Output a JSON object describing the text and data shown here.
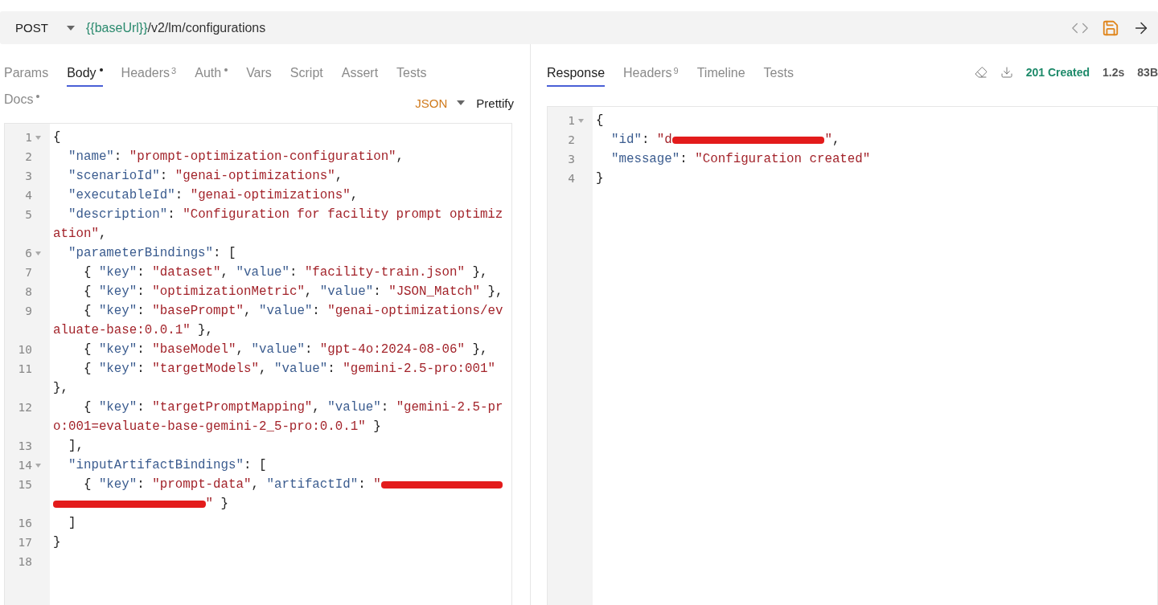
{
  "request": {
    "method": "POST",
    "url_variable": "{{baseUrl}}",
    "url_path": "/v2/lm/configurations"
  },
  "request_tabs": [
    {
      "label": "Params",
      "selected": false,
      "modified": false
    },
    {
      "label": "Body",
      "selected": true,
      "modified": true
    },
    {
      "label": "Headers",
      "count": "3",
      "selected": false,
      "modified": false
    },
    {
      "label": "Auth",
      "selected": false,
      "modified": true
    },
    {
      "label": "Vars",
      "selected": false,
      "modified": false
    },
    {
      "label": "Script",
      "selected": false,
      "modified": false
    },
    {
      "label": "Assert",
      "selected": false,
      "modified": false
    },
    {
      "label": "Tests",
      "selected": false,
      "modified": false
    },
    {
      "label": "Docs",
      "selected": false,
      "modified": true
    }
  ],
  "body_mode": {
    "format": "JSON",
    "action": "Prettify"
  },
  "request_body": [
    {
      "number": "1",
      "fold": true,
      "segments": [
        {
          "kind": "punct",
          "text": "{"
        }
      ]
    },
    {
      "number": "2",
      "fold": false,
      "segments": [
        {
          "kind": "key",
          "text": "  \"name\""
        },
        {
          "kind": "punct",
          "text": ": "
        },
        {
          "kind": "str",
          "text": "\"prompt-optimization-configuration\""
        },
        {
          "kind": "punct",
          "text": ","
        }
      ]
    },
    {
      "number": "3",
      "fold": false,
      "segments": [
        {
          "kind": "key",
          "text": "  \"scenarioId\""
        },
        {
          "kind": "punct",
          "text": ": "
        },
        {
          "kind": "str",
          "text": "\"genai-optimizations\""
        },
        {
          "kind": "punct",
          "text": ","
        }
      ]
    },
    {
      "number": "4",
      "fold": false,
      "segments": [
        {
          "kind": "key",
          "text": "  \"executableId\""
        },
        {
          "kind": "punct",
          "text": ": "
        },
        {
          "kind": "str",
          "text": "\"genai-optimizations\""
        },
        {
          "kind": "punct",
          "text": ","
        }
      ]
    },
    {
      "number": "5",
      "fold": false,
      "segments": [
        {
          "kind": "key",
          "text": "  \"description\""
        },
        {
          "kind": "punct",
          "text": ": "
        },
        {
          "kind": "str",
          "text": "\"Configuration for facility prompt optimiz"
        }
      ]
    },
    {
      "fold": false,
      "segments": [
        {
          "kind": "str",
          "text": "ation\""
        },
        {
          "kind": "punct",
          "text": ","
        }
      ]
    },
    {
      "number": "6",
      "fold": true,
      "segments": [
        {
          "kind": "key",
          "text": "  \"parameterBindings\""
        },
        {
          "kind": "punct",
          "text": ": ["
        }
      ]
    },
    {
      "number": "7",
      "fold": false,
      "segments": [
        {
          "kind": "punct",
          "text": "    { "
        },
        {
          "kind": "key",
          "text": "\"key\""
        },
        {
          "kind": "punct",
          "text": ": "
        },
        {
          "kind": "str",
          "text": "\"dataset\""
        },
        {
          "kind": "punct",
          "text": ", "
        },
        {
          "kind": "key",
          "text": "\"value\""
        },
        {
          "kind": "punct",
          "text": ": "
        },
        {
          "kind": "str",
          "text": "\"facility-train.json\""
        },
        {
          "kind": "punct",
          "text": " },"
        }
      ]
    },
    {
      "number": "8",
      "fold": false,
      "segments": [
        {
          "kind": "punct",
          "text": "    { "
        },
        {
          "kind": "key",
          "text": "\"key\""
        },
        {
          "kind": "punct",
          "text": ": "
        },
        {
          "kind": "str",
          "text": "\"optimizationMetric\""
        },
        {
          "kind": "punct",
          "text": ", "
        },
        {
          "kind": "key",
          "text": "\"value\""
        },
        {
          "kind": "punct",
          "text": ": "
        },
        {
          "kind": "str",
          "text": "\"JSON_Match\""
        },
        {
          "kind": "punct",
          "text": " },"
        }
      ]
    },
    {
      "number": "9",
      "fold": false,
      "segments": [
        {
          "kind": "punct",
          "text": "    { "
        },
        {
          "kind": "key",
          "text": "\"key\""
        },
        {
          "kind": "punct",
          "text": ": "
        },
        {
          "kind": "str",
          "text": "\"basePrompt\""
        },
        {
          "kind": "punct",
          "text": ", "
        },
        {
          "kind": "key",
          "text": "\"value\""
        },
        {
          "kind": "punct",
          "text": ": "
        },
        {
          "kind": "str",
          "text": "\"genai-optimizations/ev"
        }
      ]
    },
    {
      "fold": false,
      "segments": [
        {
          "kind": "str",
          "text": "aluate-base:0.0.1\""
        },
        {
          "kind": "punct",
          "text": " },"
        }
      ]
    },
    {
      "number": "10",
      "fold": false,
      "segments": [
        {
          "kind": "punct",
          "text": "    { "
        },
        {
          "kind": "key",
          "text": "\"key\""
        },
        {
          "kind": "punct",
          "text": ": "
        },
        {
          "kind": "str",
          "text": "\"baseModel\""
        },
        {
          "kind": "punct",
          "text": ", "
        },
        {
          "kind": "key",
          "text": "\"value\""
        },
        {
          "kind": "punct",
          "text": ": "
        },
        {
          "kind": "str",
          "text": "\"gpt-4o:2024-08-06\""
        },
        {
          "kind": "punct",
          "text": " },"
        }
      ]
    },
    {
      "number": "11",
      "fold": false,
      "segments": [
        {
          "kind": "punct",
          "text": "    { "
        },
        {
          "kind": "key",
          "text": "\"key\""
        },
        {
          "kind": "punct",
          "text": ": "
        },
        {
          "kind": "str",
          "text": "\"targetModels\""
        },
        {
          "kind": "punct",
          "text": ", "
        },
        {
          "kind": "key",
          "text": "\"value\""
        },
        {
          "kind": "punct",
          "text": ": "
        },
        {
          "kind": "str",
          "text": "\"gemini-2.5-pro:001\""
        }
      ]
    },
    {
      "fold": false,
      "segments": [
        {
          "kind": "punct",
          "text": "},"
        }
      ]
    },
    {
      "number": "12",
      "fold": false,
      "segments": [
        {
          "kind": "punct",
          "text": "    { "
        },
        {
          "kind": "key",
          "text": "\"key\""
        },
        {
          "kind": "punct",
          "text": ": "
        },
        {
          "kind": "str",
          "text": "\"targetPromptMapping\""
        },
        {
          "kind": "punct",
          "text": ", "
        },
        {
          "kind": "key",
          "text": "\"value\""
        },
        {
          "kind": "punct",
          "text": ": "
        },
        {
          "kind": "str",
          "text": "\"gemini-2.5-pr"
        }
      ]
    },
    {
      "fold": false,
      "segments": [
        {
          "kind": "str",
          "text": "o:001=evaluate-base-gemini-2_5-pro:0.0.1\""
        },
        {
          "kind": "punct",
          "text": " }"
        }
      ]
    },
    {
      "number": "13",
      "fold": false,
      "segments": [
        {
          "kind": "punct",
          "text": "  ],"
        }
      ]
    },
    {
      "number": "14",
      "fold": true,
      "segments": [
        {
          "kind": "key",
          "text": "  \"inputArtifactBindings\""
        },
        {
          "kind": "punct",
          "text": ": ["
        }
      ]
    },
    {
      "number": "15",
      "fold": false,
      "segments": [
        {
          "kind": "punct",
          "text": "    { "
        },
        {
          "kind": "key",
          "text": "\"key\""
        },
        {
          "kind": "punct",
          "text": ": "
        },
        {
          "kind": "str",
          "text": "\"prompt-data\""
        },
        {
          "kind": "punct",
          "text": ", "
        },
        {
          "kind": "key",
          "text": "\"artifactId\""
        },
        {
          "kind": "punct",
          "text": ": "
        },
        {
          "kind": "str",
          "text": "\""
        },
        {
          "kind": "redacted"
        }
      ]
    },
    {
      "fold": false,
      "segments": [
        {
          "kind": "redacted"
        },
        {
          "kind": "str",
          "text": "\""
        },
        {
          "kind": "punct",
          "text": " }"
        }
      ]
    },
    {
      "number": "16",
      "fold": false,
      "segments": [
        {
          "kind": "punct",
          "text": "  ]"
        }
      ]
    },
    {
      "number": "17",
      "fold": false,
      "segments": [
        {
          "kind": "punct",
          "text": "}"
        }
      ]
    },
    {
      "number": "18",
      "fold": false
    }
  ],
  "response_tabs": [
    {
      "label": "Response",
      "selected": true
    },
    {
      "label": "Headers",
      "count": "9",
      "selected": false
    },
    {
      "label": "Timeline",
      "selected": false
    },
    {
      "label": "Tests",
      "selected": false
    }
  ],
  "response_status": {
    "status": "201 Created",
    "time": "1.2s",
    "size": "83B"
  },
  "response_body": [
    {
      "number": "1",
      "fold": true,
      "segments": [
        {
          "kind": "punct",
          "text": "{"
        }
      ]
    },
    {
      "number": "2",
      "fold": false,
      "segments": [
        {
          "kind": "key",
          "text": "  \"id\""
        },
        {
          "kind": "punct",
          "text": ": "
        },
        {
          "kind": "str",
          "text": "\"d"
        },
        {
          "kind": "redacted"
        },
        {
          "kind": "str",
          "text": "\""
        },
        {
          "kind": "punct",
          "text": ","
        }
      ]
    },
    {
      "number": "3",
      "fold": false,
      "segments": [
        {
          "kind": "key",
          "text": "  \"message\""
        },
        {
          "kind": "punct",
          "text": ": "
        },
        {
          "kind": "str",
          "text": "\"Configuration created\""
        }
      ]
    },
    {
      "number": "4",
      "fold": false,
      "segments": [
        {
          "kind": "punct",
          "text": "}"
        }
      ]
    }
  ]
}
